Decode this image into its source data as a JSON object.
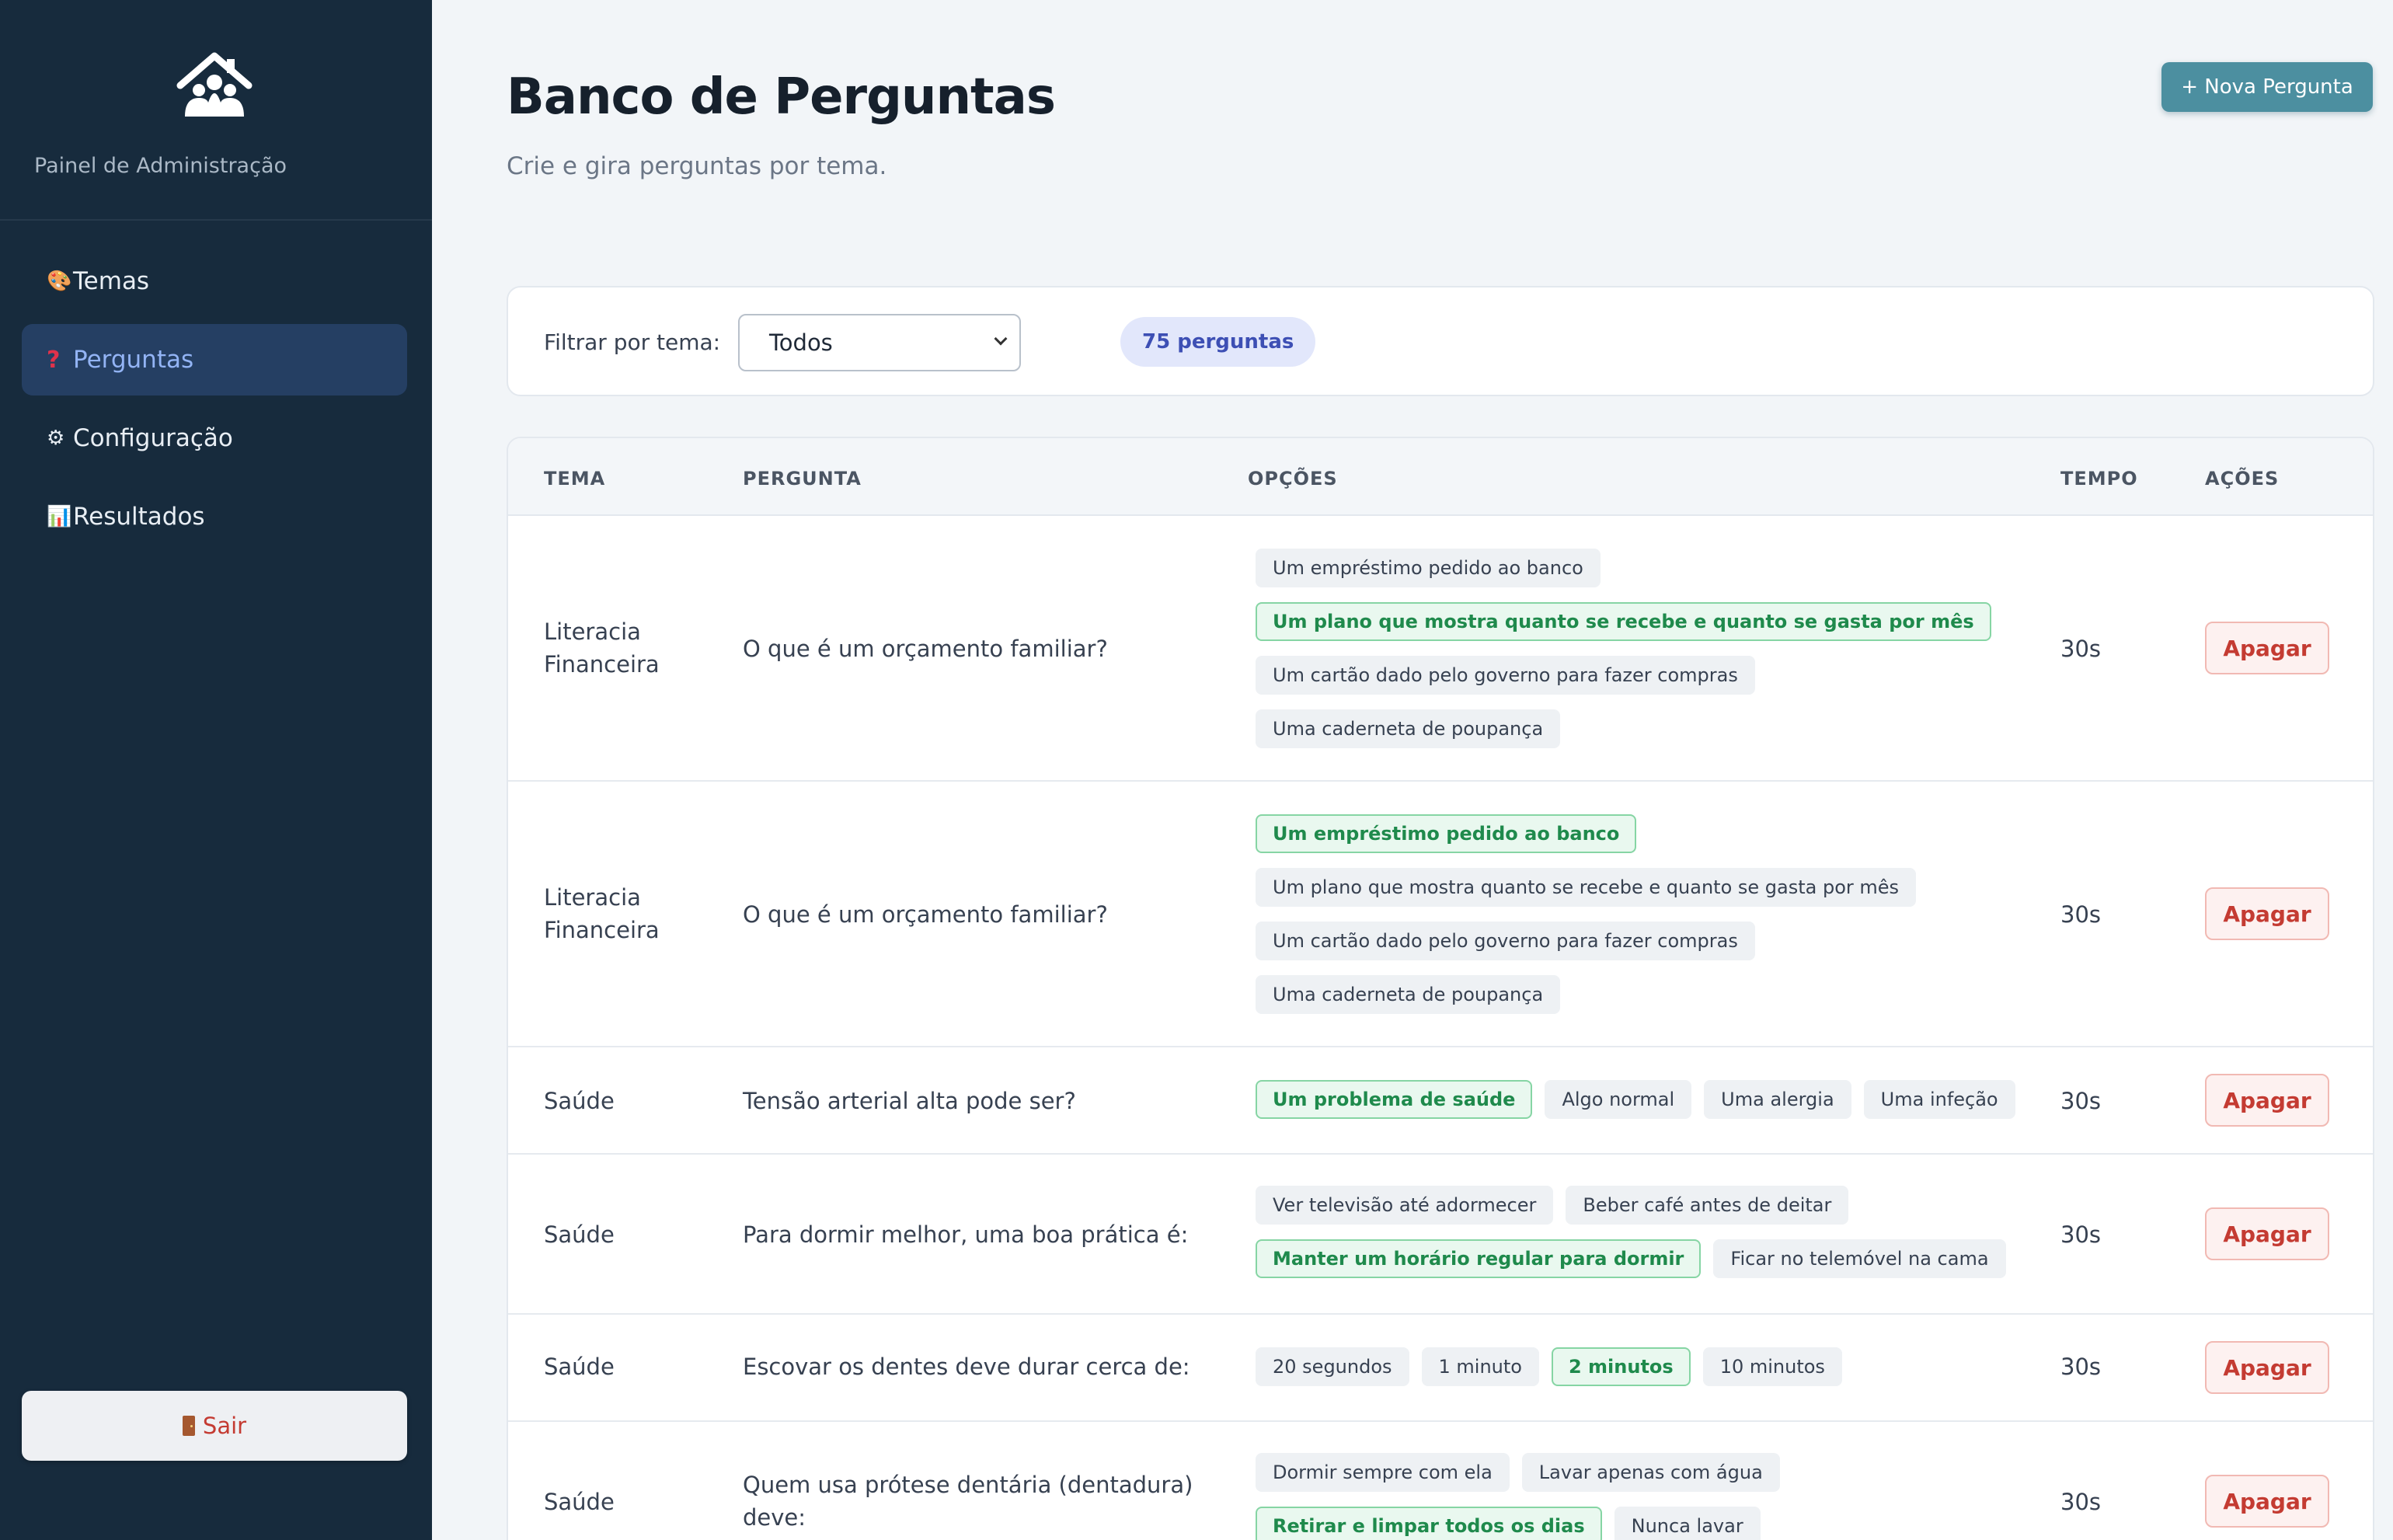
{
  "sidebar": {
    "brand_text": "Painel de Administração",
    "items": [
      {
        "icon": "palette-icon",
        "glyph": "🎨",
        "label": "Temas"
      },
      {
        "icon": "question-icon",
        "glyph": "?",
        "label": "Perguntas",
        "active": true
      },
      {
        "icon": "gear-icon",
        "glyph": "⚙",
        "label": "Configuração"
      },
      {
        "icon": "chart-icon",
        "glyph": "📊",
        "label": "Resultados"
      }
    ],
    "logout_label": "Sair"
  },
  "header": {
    "title": "Banco de Perguntas",
    "subtitle": "Crie e gira perguntas por tema.",
    "new_button": "+ Nova Pergunta"
  },
  "filter": {
    "label": "Filtrar por tema:",
    "selected": "Todos",
    "count": "75 perguntas"
  },
  "table": {
    "headers": [
      "TEMA",
      "PERGUNTA",
      "OPÇÕES",
      "TEMPO",
      "AÇÕES"
    ],
    "delete_label": "Apagar",
    "rows": [
      {
        "tema": "Literacia Financeira",
        "pergunta": "O que é um orçamento familiar?",
        "tempo": "30s",
        "opcoes": [
          {
            "text": "Um empréstimo pedido ao banco",
            "correct": false
          },
          {
            "text": "Um plano que mostra quanto se recebe e quanto se gasta por mês",
            "correct": true
          },
          {
            "text": "Um cartão dado pelo governo para fazer compras",
            "correct": false
          },
          {
            "text": "Uma caderneta de poupança",
            "correct": false
          }
        ]
      },
      {
        "tema": "Literacia Financeira",
        "pergunta": "O que é um orçamento familiar?",
        "tempo": "30s",
        "opcoes": [
          {
            "text": "Um empréstimo pedido ao banco",
            "correct": true
          },
          {
            "text": "Um plano que mostra quanto se recebe e quanto se gasta por mês",
            "correct": false
          },
          {
            "text": "Um cartão dado pelo governo para fazer compras",
            "correct": false
          },
          {
            "text": "Uma caderneta de poupança",
            "correct": false
          }
        ]
      },
      {
        "tema": "Saúde",
        "pergunta": "Tensão arterial alta pode ser?",
        "tempo": "30s",
        "opcoes": [
          {
            "text": "Um problema de saúde",
            "correct": true
          },
          {
            "text": "Algo normal",
            "correct": false
          },
          {
            "text": "Uma alergia",
            "correct": false
          },
          {
            "text": "Uma infeção",
            "correct": false
          }
        ]
      },
      {
        "tema": "Saúde",
        "pergunta": "Para dormir melhor, uma boa prática é:",
        "tempo": "30s",
        "opcoes": [
          {
            "text": "Ver televisão até adormecer",
            "correct": false
          },
          {
            "text": "Beber café antes de deitar",
            "correct": false
          },
          {
            "text": "Manter um horário regular para dormir",
            "correct": true
          },
          {
            "text": "Ficar no telemóvel na cama",
            "correct": false
          }
        ]
      },
      {
        "tema": "Saúde",
        "pergunta": "Escovar os dentes deve durar cerca de:",
        "tempo": "30s",
        "opcoes": [
          {
            "text": "20 segundos",
            "correct": false
          },
          {
            "text": "1 minuto",
            "correct": false
          },
          {
            "text": "2 minutos",
            "correct": true
          },
          {
            "text": "10 minutos",
            "correct": false
          }
        ]
      },
      {
        "tema": "Saúde",
        "pergunta": "Quem usa prótese dentária (dentadura) deve:",
        "tempo": "30s",
        "opcoes": [
          {
            "text": "Dormir sempre com ela",
            "correct": false
          },
          {
            "text": "Lavar apenas com água",
            "correct": false
          },
          {
            "text": "Retirar e limpar todos os dias",
            "correct": true
          },
          {
            "text": "Nunca lavar",
            "correct": false
          }
        ]
      }
    ]
  },
  "colors": {
    "sidebar_bg": "#172b3d",
    "accent": "#4c8fa0",
    "correct": "#1f8a4c",
    "danger": "#c43b32"
  }
}
